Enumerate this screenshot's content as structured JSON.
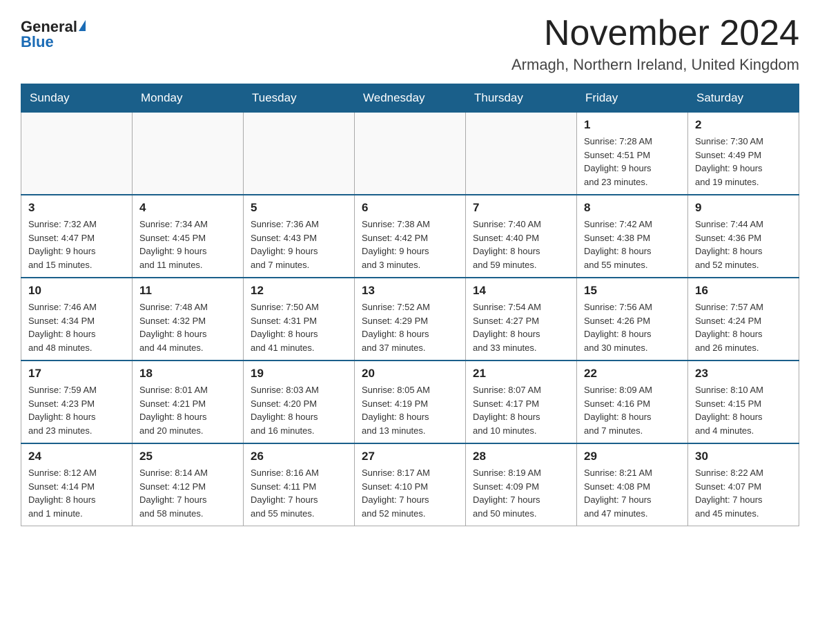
{
  "logo": {
    "general": "General",
    "blue": "Blue"
  },
  "title": "November 2024",
  "location": "Armagh, Northern Ireland, United Kingdom",
  "days_of_week": [
    "Sunday",
    "Monday",
    "Tuesday",
    "Wednesday",
    "Thursday",
    "Friday",
    "Saturday"
  ],
  "weeks": [
    [
      {
        "day": "",
        "info": ""
      },
      {
        "day": "",
        "info": ""
      },
      {
        "day": "",
        "info": ""
      },
      {
        "day": "",
        "info": ""
      },
      {
        "day": "",
        "info": ""
      },
      {
        "day": "1",
        "info": "Sunrise: 7:28 AM\nSunset: 4:51 PM\nDaylight: 9 hours\nand 23 minutes."
      },
      {
        "day": "2",
        "info": "Sunrise: 7:30 AM\nSunset: 4:49 PM\nDaylight: 9 hours\nand 19 minutes."
      }
    ],
    [
      {
        "day": "3",
        "info": "Sunrise: 7:32 AM\nSunset: 4:47 PM\nDaylight: 9 hours\nand 15 minutes."
      },
      {
        "day": "4",
        "info": "Sunrise: 7:34 AM\nSunset: 4:45 PM\nDaylight: 9 hours\nand 11 minutes."
      },
      {
        "day": "5",
        "info": "Sunrise: 7:36 AM\nSunset: 4:43 PM\nDaylight: 9 hours\nand 7 minutes."
      },
      {
        "day": "6",
        "info": "Sunrise: 7:38 AM\nSunset: 4:42 PM\nDaylight: 9 hours\nand 3 minutes."
      },
      {
        "day": "7",
        "info": "Sunrise: 7:40 AM\nSunset: 4:40 PM\nDaylight: 8 hours\nand 59 minutes."
      },
      {
        "day": "8",
        "info": "Sunrise: 7:42 AM\nSunset: 4:38 PM\nDaylight: 8 hours\nand 55 minutes."
      },
      {
        "day": "9",
        "info": "Sunrise: 7:44 AM\nSunset: 4:36 PM\nDaylight: 8 hours\nand 52 minutes."
      }
    ],
    [
      {
        "day": "10",
        "info": "Sunrise: 7:46 AM\nSunset: 4:34 PM\nDaylight: 8 hours\nand 48 minutes."
      },
      {
        "day": "11",
        "info": "Sunrise: 7:48 AM\nSunset: 4:32 PM\nDaylight: 8 hours\nand 44 minutes."
      },
      {
        "day": "12",
        "info": "Sunrise: 7:50 AM\nSunset: 4:31 PM\nDaylight: 8 hours\nand 41 minutes."
      },
      {
        "day": "13",
        "info": "Sunrise: 7:52 AM\nSunset: 4:29 PM\nDaylight: 8 hours\nand 37 minutes."
      },
      {
        "day": "14",
        "info": "Sunrise: 7:54 AM\nSunset: 4:27 PM\nDaylight: 8 hours\nand 33 minutes."
      },
      {
        "day": "15",
        "info": "Sunrise: 7:56 AM\nSunset: 4:26 PM\nDaylight: 8 hours\nand 30 minutes."
      },
      {
        "day": "16",
        "info": "Sunrise: 7:57 AM\nSunset: 4:24 PM\nDaylight: 8 hours\nand 26 minutes."
      }
    ],
    [
      {
        "day": "17",
        "info": "Sunrise: 7:59 AM\nSunset: 4:23 PM\nDaylight: 8 hours\nand 23 minutes."
      },
      {
        "day": "18",
        "info": "Sunrise: 8:01 AM\nSunset: 4:21 PM\nDaylight: 8 hours\nand 20 minutes."
      },
      {
        "day": "19",
        "info": "Sunrise: 8:03 AM\nSunset: 4:20 PM\nDaylight: 8 hours\nand 16 minutes."
      },
      {
        "day": "20",
        "info": "Sunrise: 8:05 AM\nSunset: 4:19 PM\nDaylight: 8 hours\nand 13 minutes."
      },
      {
        "day": "21",
        "info": "Sunrise: 8:07 AM\nSunset: 4:17 PM\nDaylight: 8 hours\nand 10 minutes."
      },
      {
        "day": "22",
        "info": "Sunrise: 8:09 AM\nSunset: 4:16 PM\nDaylight: 8 hours\nand 7 minutes."
      },
      {
        "day": "23",
        "info": "Sunrise: 8:10 AM\nSunset: 4:15 PM\nDaylight: 8 hours\nand 4 minutes."
      }
    ],
    [
      {
        "day": "24",
        "info": "Sunrise: 8:12 AM\nSunset: 4:14 PM\nDaylight: 8 hours\nand 1 minute."
      },
      {
        "day": "25",
        "info": "Sunrise: 8:14 AM\nSunset: 4:12 PM\nDaylight: 7 hours\nand 58 minutes."
      },
      {
        "day": "26",
        "info": "Sunrise: 8:16 AM\nSunset: 4:11 PM\nDaylight: 7 hours\nand 55 minutes."
      },
      {
        "day": "27",
        "info": "Sunrise: 8:17 AM\nSunset: 4:10 PM\nDaylight: 7 hours\nand 52 minutes."
      },
      {
        "day": "28",
        "info": "Sunrise: 8:19 AM\nSunset: 4:09 PM\nDaylight: 7 hours\nand 50 minutes."
      },
      {
        "day": "29",
        "info": "Sunrise: 8:21 AM\nSunset: 4:08 PM\nDaylight: 7 hours\nand 47 minutes."
      },
      {
        "day": "30",
        "info": "Sunrise: 8:22 AM\nSunset: 4:07 PM\nDaylight: 7 hours\nand 45 minutes."
      }
    ]
  ]
}
